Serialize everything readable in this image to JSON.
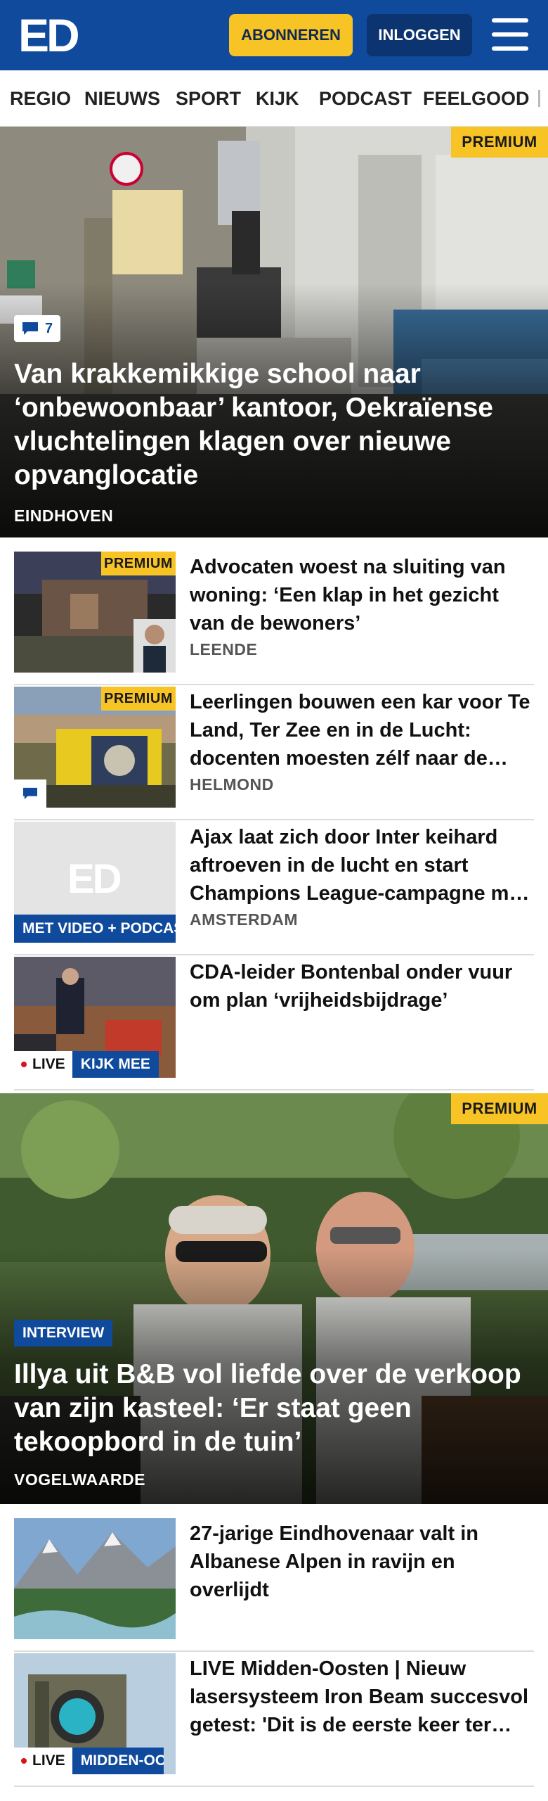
{
  "header": {
    "logo_text": "ED",
    "subscribe_label": "ABONNEREN",
    "login_label": "INLOGGEN",
    "menu_icon": "hamburger-menu-icon"
  },
  "nav": {
    "items": [
      "REGIO",
      "NIEUWS",
      "SPORT",
      "KIJK",
      "PODCAST",
      "FEELGOOD"
    ]
  },
  "hero1": {
    "premium": "PREMIUM",
    "comment_count": "7",
    "title": "Van krakkemikkige school naar ‘onbewoonbaar’ kantoor, Oekraïense vluchtelingen klagen over nieuwe opvanglocatie",
    "location": "EINDHOVEN"
  },
  "articles1": [
    {
      "title": "Advocaten woest na sluiting van woning: ‘Een klap in het gezicht van de bewoners’",
      "location": "LEENDE",
      "premium": "PREMIUM"
    },
    {
      "title": "Leerlingen bouwen een kar voor Te Land, Ter Zee en in de Lucht: docenten moesten zélf naar de werkplaats",
      "location": "HELMOND",
      "premium": "PREMIUM"
    },
    {
      "title": "Ajax laat zich door Inter keihard aftroeven in de lucht en start Champions League-campagne met nederlaag",
      "location": "AMSTERDAM",
      "video_tag": "MET VIDEO + PODCAST",
      "placeholder_logo": "ED"
    },
    {
      "title": "CDA-leider Bontenbal onder vuur om plan ‘vrijheidsbijdrage’",
      "live": "LIVE",
      "live_extra": "KIJK MEE"
    }
  ],
  "hero2": {
    "premium": "PREMIUM",
    "tag": "INTERVIEW",
    "title": "Illya uit B&B vol liefde over de verkoop van zijn kasteel: ‘Er staat geen tekoopbord in de tuin’",
    "location": "VOGELWAARDE"
  },
  "articles2": [
    {
      "title": "27-jarige Eindhovenaar valt in Albanese Alpen in ravijn en overlijdt"
    },
    {
      "title": "LIVE Midden-Oosten | Nieuw lasersysteem Iron Beam succesvol getest: 'Dit is de eerste keer ter wereld'",
      "live": "LIVE",
      "live_extra": "MIDDEN-OOSTEN"
    }
  ],
  "colors": {
    "brand_blue": "#0f4a9c",
    "premium_yellow": "#f7c325",
    "live_red": "#d7141a"
  }
}
